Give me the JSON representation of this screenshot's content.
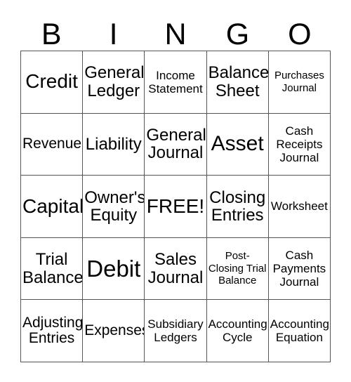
{
  "card": {
    "title": "BINGO",
    "header_letters": [
      "B",
      "I",
      "N",
      "G",
      "O"
    ],
    "columns": 5,
    "rows": 5,
    "free_space_label": "FREE!",
    "colors": {
      "background": "#ffffff",
      "text": "#000000",
      "grid_line": "#555555"
    },
    "cells": [
      {
        "label": "Credit",
        "size": "lg",
        "free": false
      },
      {
        "label": "General Ledger",
        "size": "md",
        "free": false
      },
      {
        "label": "Income Statement",
        "size": "xs",
        "free": false
      },
      {
        "label": "Balance Sheet",
        "size": "md",
        "free": false
      },
      {
        "label": "Purchases Journal",
        "size": "xxs",
        "free": false
      },
      {
        "label": "Revenue",
        "size": "sm",
        "free": false
      },
      {
        "label": "Liability",
        "size": "md",
        "free": false
      },
      {
        "label": "General Journal",
        "size": "md",
        "free": false
      },
      {
        "label": "Asset",
        "size": "xl",
        "free": false
      },
      {
        "label": "Cash Receipts Journal",
        "size": "xs",
        "free": false
      },
      {
        "label": "Capital",
        "size": "lg",
        "free": false
      },
      {
        "label": "Owner's Equity",
        "size": "md",
        "free": false
      },
      {
        "label": "FREE!",
        "size": "lg",
        "free": true
      },
      {
        "label": "Closing Entries",
        "size": "md",
        "free": false
      },
      {
        "label": "Worksheet",
        "size": "xs",
        "free": false
      },
      {
        "label": "Trial Balance",
        "size": "md",
        "free": false
      },
      {
        "label": "Debit",
        "size": "xxl",
        "free": false
      },
      {
        "label": "Sales Journal",
        "size": "md",
        "free": false
      },
      {
        "label": "Post-Closing Trial Balance",
        "size": "xxs",
        "free": false
      },
      {
        "label": "Cash Payments Journal",
        "size": "xs",
        "free": false
      },
      {
        "label": "Adjusting Entries",
        "size": "sm",
        "free": false
      },
      {
        "label": "Expenses",
        "size": "sm",
        "free": false
      },
      {
        "label": "Subsidiary Ledgers",
        "size": "xs",
        "free": false
      },
      {
        "label": "Accounting Cycle",
        "size": "xs",
        "free": false
      },
      {
        "label": "Accounting Equation",
        "size": "xs",
        "free": false
      }
    ]
  }
}
